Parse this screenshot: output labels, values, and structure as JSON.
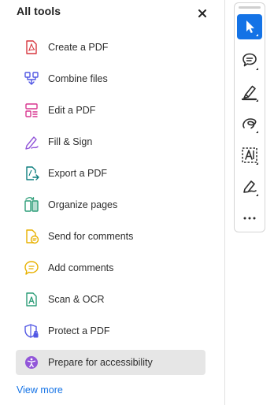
{
  "panel": {
    "title": "All tools",
    "close_label": "Close"
  },
  "tools": [
    {
      "label": "Create a PDF",
      "icon": "create-pdf-icon",
      "color": "#d7373f"
    },
    {
      "label": "Combine files",
      "icon": "combine-files-icon",
      "color": "#5258e4"
    },
    {
      "label": "Edit a PDF",
      "icon": "edit-pdf-icon",
      "color": "#d83790"
    },
    {
      "label": "Fill & Sign",
      "icon": "fill-sign-icon",
      "color": "#9256d9"
    },
    {
      "label": "Export a PDF",
      "icon": "export-pdf-icon",
      "color": "#0d7f7f"
    },
    {
      "label": "Organize pages",
      "icon": "organize-pages-icon",
      "color": "#2d9d78"
    },
    {
      "label": "Send for comments",
      "icon": "send-comments-icon",
      "color": "#e8b100"
    },
    {
      "label": "Add comments",
      "icon": "add-comments-icon",
      "color": "#e8b100"
    },
    {
      "label": "Scan & OCR",
      "icon": "scan-ocr-icon",
      "color": "#2d9d78"
    },
    {
      "label": "Protect a PDF",
      "icon": "protect-pdf-icon",
      "color": "#5258e4"
    },
    {
      "label": "Prepare for accessibility",
      "icon": "accessibility-icon",
      "color": "#9256d9",
      "active": true
    }
  ],
  "view_more": "View more",
  "toolbar": {
    "buttons": [
      {
        "icon": "select-cursor-icon",
        "selected": true
      },
      {
        "icon": "comment-icon"
      },
      {
        "icon": "highlight-pen-icon"
      },
      {
        "icon": "draw-freehand-icon"
      },
      {
        "icon": "text-select-icon"
      },
      {
        "icon": "sign-pen-icon"
      },
      {
        "icon": "more-options-icon"
      }
    ]
  },
  "colors": {
    "accent": "#1473e6",
    "active_row": "#e6e6e6"
  }
}
